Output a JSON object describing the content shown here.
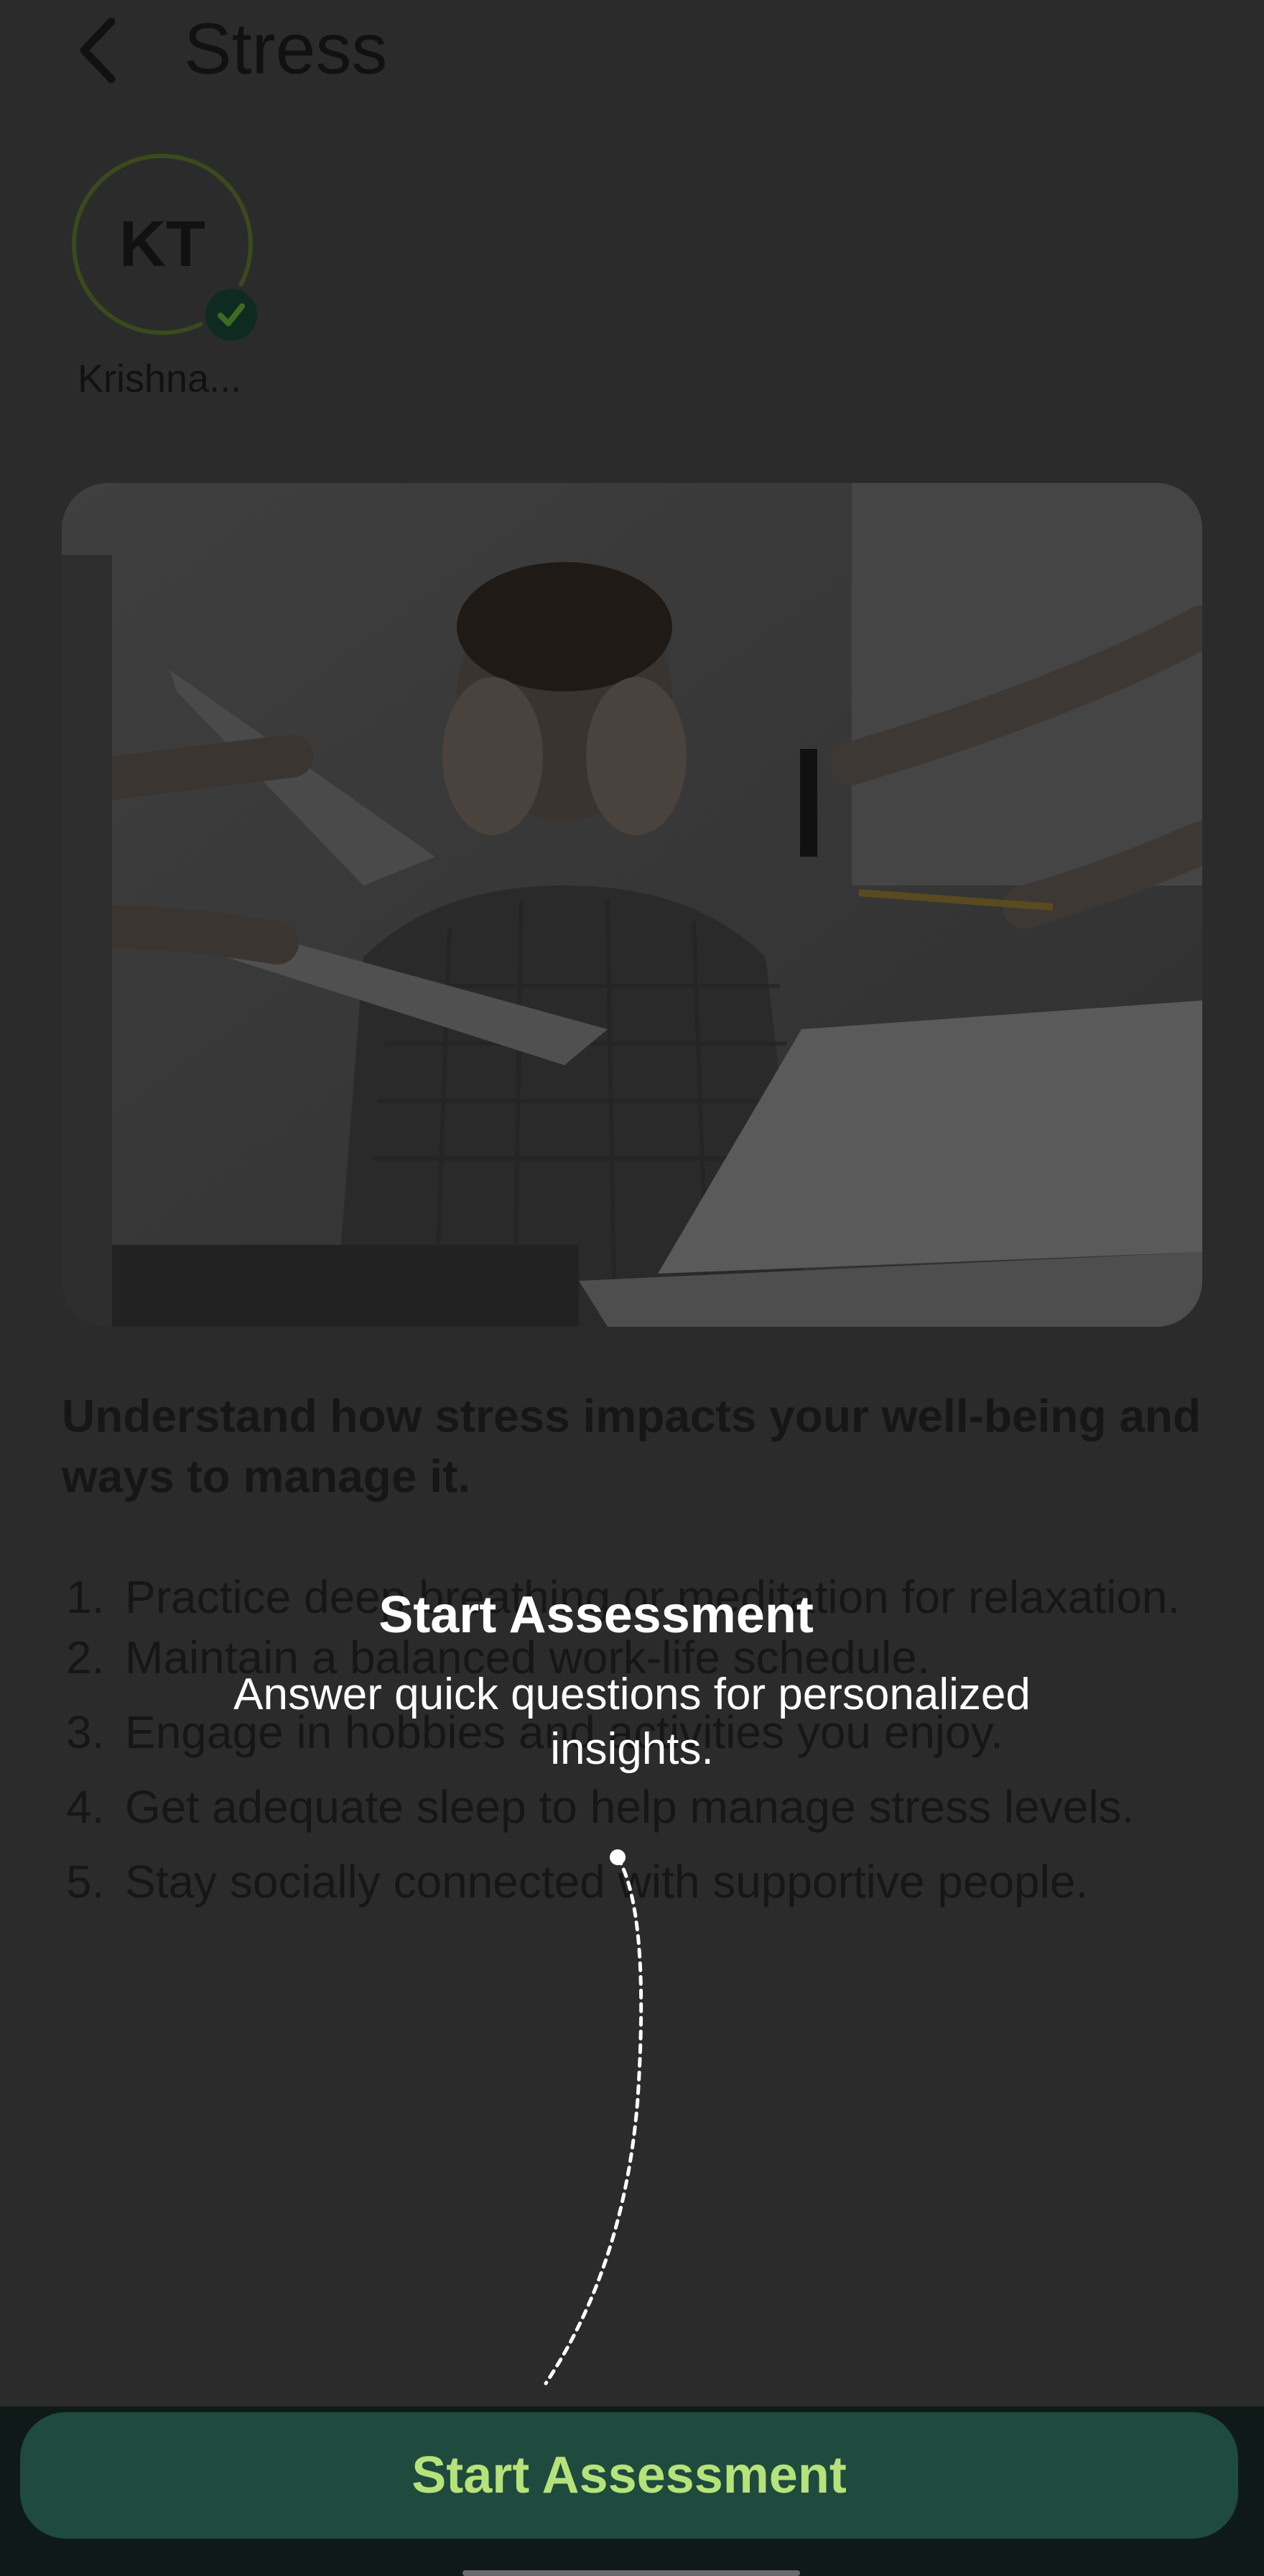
{
  "header": {
    "title": "Stress",
    "back_icon": "chevron-left-icon"
  },
  "profile": {
    "initials": "KT",
    "name": "Krishna...",
    "verified_icon": "check-badge-icon"
  },
  "hero_image": {
    "description_icon": "stressed-person-photo"
  },
  "intro": "Understand how stress impacts your well-being and ways to manage it.",
  "tips": [
    {
      "num": "1.",
      "text": "Practice deep breathing or meditation for relaxation."
    },
    {
      "num": "2.",
      "text": "Maintain a balanced work-life schedule."
    },
    {
      "num": "3.",
      "text": "Engage in hobbies and activities you enjoy."
    },
    {
      "num": "4.",
      "text": "Get adequate sleep to help manage stress levels."
    },
    {
      "num": "5.",
      "text": "Stay socially connected with supportive people."
    }
  ],
  "coachmark": {
    "title": "Start Assessment",
    "description": "Answer quick questions for personalized insights."
  },
  "bottom": {
    "start_label": "Start Assessment"
  },
  "colors": {
    "accent_text": "#b5e37a",
    "button_bg": "#1f4a3e",
    "overlay_bg": "#2b2b2b"
  }
}
